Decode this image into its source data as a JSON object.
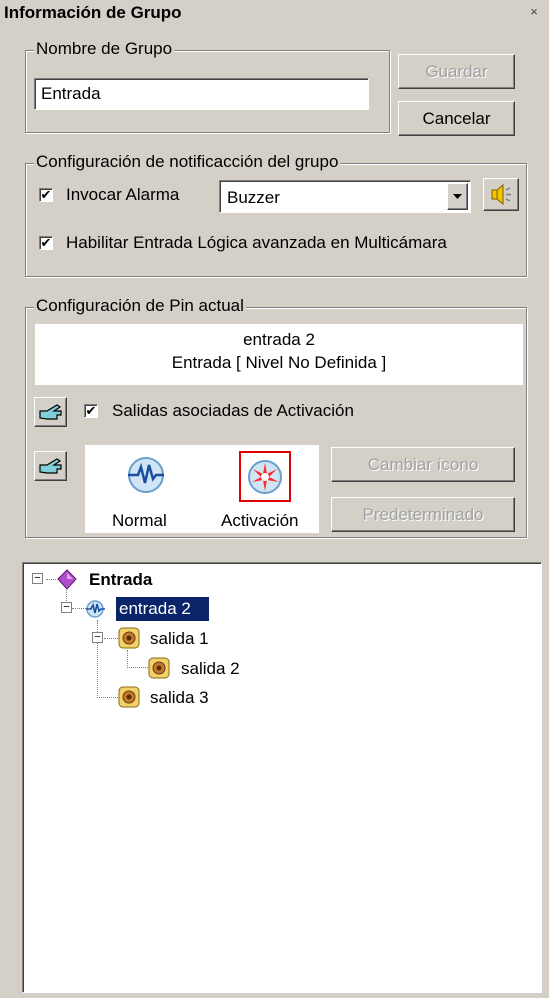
{
  "window": {
    "title": "Información de Grupo",
    "close_glyph": "×"
  },
  "group_name": {
    "legend": "Nombre de Grupo",
    "value": "Entrada",
    "save_label": "Guardar",
    "cancel_label": "Cancelar"
  },
  "notification": {
    "legend": "Configuración de notificacción del grupo",
    "invoke_alarm_label": "Invocar Alarma",
    "invoke_alarm_checked": true,
    "alarm_selected": "Buzzer",
    "advanced_logic_label": "Habilitar Entrada Lógica avanzada en Multicámara",
    "advanced_logic_checked": true
  },
  "pin": {
    "legend": "Configuración de Pin actual",
    "name": "entrada 2",
    "description": "Entrada [ Nivel No Definida ]",
    "outputs_label": "Salidas asociadas de Activación",
    "outputs_checked": true,
    "icon_normal_label": "Normal",
    "icon_activation_label": "Activación",
    "change_icon_label": "Cambiar ícono",
    "default_label": "Predeterminado"
  },
  "tree": {
    "root": "Entrada",
    "input": "entrada 2",
    "outputs": [
      "salida 1",
      "salida 2",
      "salida 3"
    ]
  },
  "colors": {
    "selection": "#0a246a",
    "dialog": "#d4d0c8",
    "red_frame": "#e00000"
  }
}
